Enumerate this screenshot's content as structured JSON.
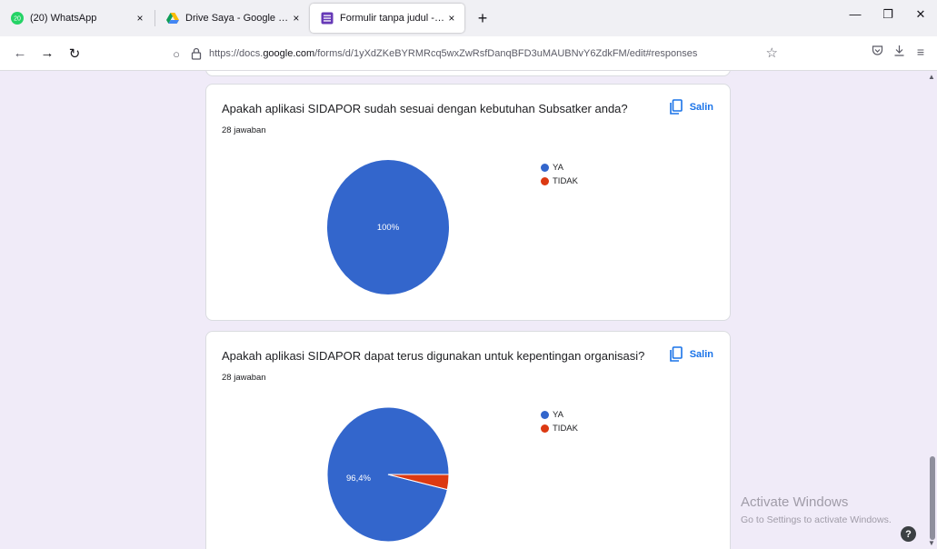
{
  "browser": {
    "tabs": [
      {
        "label": "(20) WhatsApp",
        "badge": "20",
        "active": false
      },
      {
        "label": "Drive Saya - Google Drive",
        "active": false
      },
      {
        "label": "Formulir tanpa judul - Google F",
        "active": true
      }
    ],
    "tab_close_glyph": "×",
    "new_tab_glyph": "+",
    "window_controls": {
      "minimize": "—",
      "restore": "❐",
      "close": "✕"
    },
    "url": {
      "prefix": "https://docs.",
      "host": "google.com",
      "path": "/forms/d/1yXdZKeBYRMRcq5wxZwRsfDanqBFD3uMAUBNvY6ZdkFM/edit#responses"
    }
  },
  "page": {
    "copy_label": "Salin",
    "questions": [
      {
        "title": "Apakah aplikasi SIDAPOR sudah sesuai dengan kebutuhan Subsatker anda?",
        "count": "28 jawaban"
      },
      {
        "title": "Apakah aplikasi SIDAPOR dapat terus digunakan untuk kepentingan organisasi?",
        "count": "28 jawaban"
      }
    ],
    "watermark": {
      "title": "Activate Windows",
      "subtitle": "Go to Settings to activate Windows."
    },
    "help_label": "?"
  },
  "colors": {
    "ya": "#3366cc",
    "tidak": "#dc3912",
    "accent": "#1a73e8"
  },
  "chart_data": [
    {
      "type": "pie",
      "categories": [
        "YA",
        "TIDAK"
      ],
      "values": [
        100,
        0
      ],
      "data_labels": [
        "100%"
      ],
      "legend": "right"
    },
    {
      "type": "pie",
      "categories": [
        "YA",
        "TIDAK"
      ],
      "values": [
        96.4,
        3.6
      ],
      "data_labels": [
        "96,4%"
      ],
      "legend": "right"
    }
  ]
}
